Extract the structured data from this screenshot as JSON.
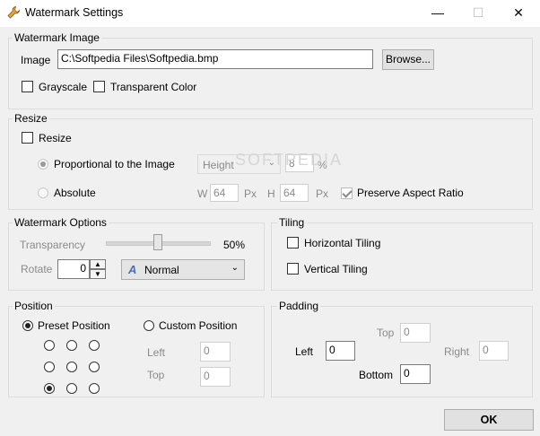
{
  "window": {
    "title": "Watermark Settings",
    "minimize": "—",
    "maximize": "☐",
    "close": "✕"
  },
  "watermark_image": {
    "legend": "Watermark Image",
    "image_label": "Image",
    "image_path": "C:\\Softpedia Files\\Softpedia.bmp",
    "browse_label": "Browse...",
    "grayscale_label": "Grayscale",
    "transparent_color_label": "Transparent Color"
  },
  "resize": {
    "legend": "Resize",
    "resize_label": "Resize",
    "proportional_label": "Proportional to the Image",
    "dimension_selected": "Height",
    "percent_value": "8",
    "percent_unit": "%",
    "absolute_label": "Absolute",
    "w_label": "W",
    "w_value": "64",
    "w_unit": "Px",
    "h_label": "H",
    "h_value": "64",
    "h_unit": "Px",
    "preserve_label": "Preserve Aspect Ratio"
  },
  "watermark_options": {
    "legend": "Watermark Options",
    "transparency_label": "Transparency",
    "transparency_value": "50%",
    "transparency_level": 0.5,
    "rotate_label": "Rotate",
    "rotate_value": "0",
    "blend_mode": "Normal"
  },
  "tiling": {
    "legend": "Tiling",
    "horizontal_label": "Horizontal Tiling",
    "vertical_label": "Vertical Tiling"
  },
  "position": {
    "legend": "Position",
    "preset_label": "Preset Position",
    "custom_label": "Custom Position",
    "left_label": "Left",
    "left_value": "0",
    "top_label": "Top",
    "top_value": "0",
    "selected_preset": "bottom-left"
  },
  "padding": {
    "legend": "Padding",
    "top_label": "Top",
    "top_value": "0",
    "left_label": "Left",
    "left_value": "0",
    "right_label": "Right",
    "right_value": "0",
    "bottom_label": "Bottom",
    "bottom_value": "0"
  },
  "footer": {
    "ok_label": "OK"
  },
  "watermark_overlay": "SOFTPEDIA"
}
